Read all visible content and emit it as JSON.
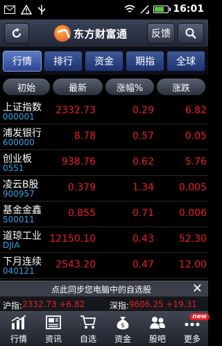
{
  "status_bar": {
    "time": "16:01",
    "icons": [
      "mail-icon",
      "warning-icon",
      "usb-icon",
      "wifi-icon",
      "vibrate-icon",
      "battery-icon"
    ]
  },
  "header": {
    "logo_text": "东方财富通",
    "feedback_label": "反馈",
    "refresh_icon": "refresh-icon",
    "search_icon": "search-icon"
  },
  "nav_tabs": [
    {
      "label": "行情",
      "active": true
    },
    {
      "label": "排行",
      "active": false
    },
    {
      "label": "资金",
      "active": false
    },
    {
      "label": "期指",
      "active": false
    },
    {
      "label": "全球",
      "active": false
    }
  ],
  "columns": [
    "初始",
    "最新",
    "涨幅%",
    "涨跌"
  ],
  "stocks": [
    {
      "name": "上证指数",
      "code": "000001",
      "price": "2332.73",
      "pct": "0.29",
      "chg": "6.82"
    },
    {
      "name": "浦发银行",
      "code": "600000",
      "price": "8.78",
      "pct": "0.57",
      "chg": "0.05"
    },
    {
      "name": "创业板",
      "code": "0551",
      "price": "938.76",
      "pct": "0.62",
      "chg": "5.76"
    },
    {
      "name": "凌云B股",
      "code": "900957",
      "price": "0.379",
      "pct": "1.34",
      "chg": "0.005"
    },
    {
      "name": "基金金鑫",
      "code": "500011",
      "price": "0.855",
      "pct": "0.71",
      "chg": "0.006"
    },
    {
      "name": "道琼工业",
      "code": "DJIA",
      "price": "12150.10",
      "pct": "0.43",
      "chg": "52.30"
    },
    {
      "name": "下月连续",
      "code": "040121",
      "price": "2543.20",
      "pct": "0.47",
      "chg": "12.00"
    }
  ],
  "banner": {
    "text": "点此同步您电脑中的自选股",
    "close_label": "✕"
  },
  "ticker": {
    "sh_label": "沪指:",
    "sh_value": "2332.73 +6.82",
    "sz_label": "深指:",
    "sz_value": "9606.25 +19.31"
  },
  "bottom_nav": [
    {
      "label": "行情",
      "icon": "chart-icon"
    },
    {
      "label": "资讯",
      "icon": "news-icon"
    },
    {
      "label": "自选",
      "icon": "cart-icon"
    },
    {
      "label": "资金",
      "icon": "money-bag-icon"
    },
    {
      "label": "股吧",
      "icon": "community-icon"
    },
    {
      "label": "更多",
      "icon": "more-icon",
      "badge": "new"
    }
  ],
  "colors": {
    "up": "#e8202a",
    "code": "#36a3e6",
    "tab": "#2a4591"
  }
}
